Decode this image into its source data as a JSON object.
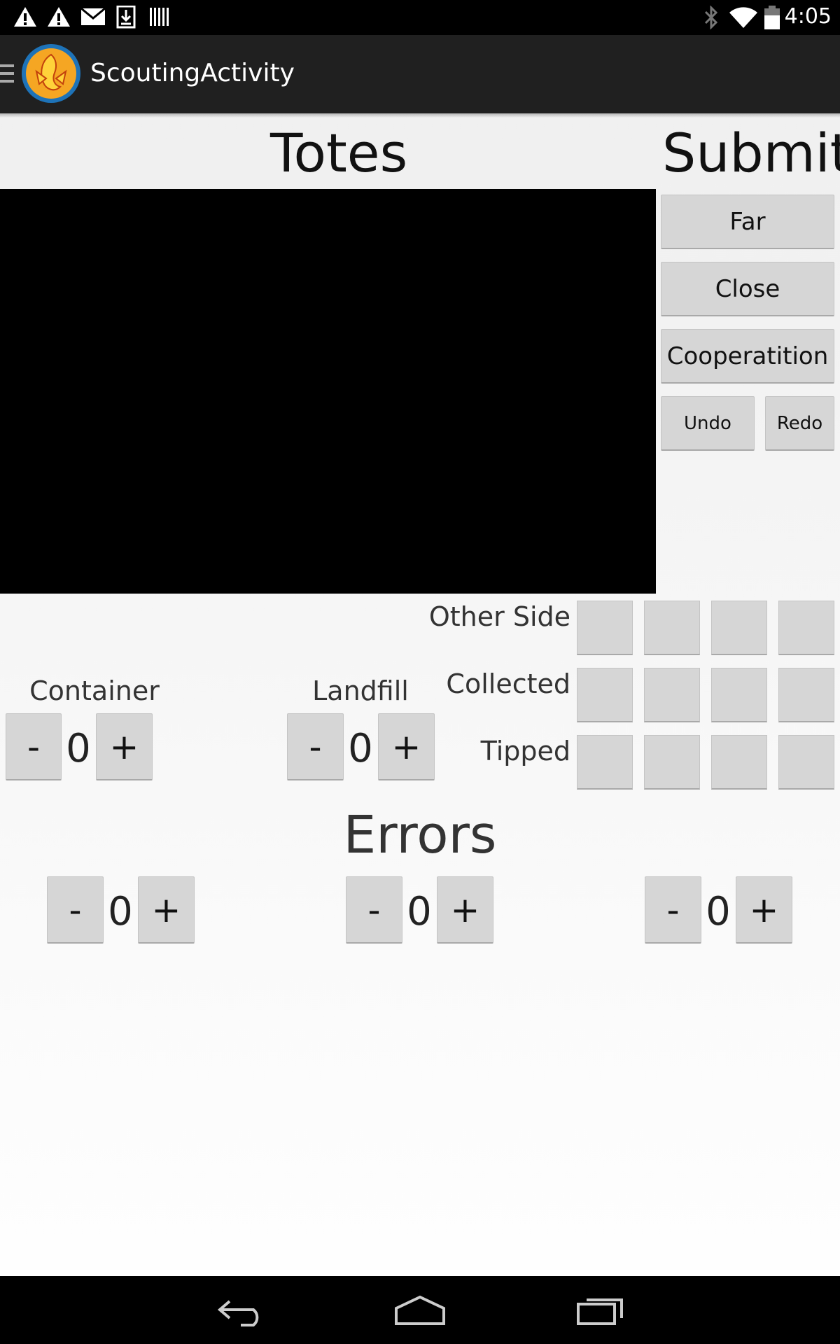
{
  "status_bar": {
    "time": "4:05",
    "left_icons": [
      "warning-icon",
      "warning-icon",
      "gmail-icon",
      "download-icon",
      "barcode-icon"
    ],
    "right_icons": [
      "bluetooth-icon",
      "wifi-icon",
      "battery-icon"
    ]
  },
  "action_bar": {
    "title": "ScoutingActivity",
    "logo_icon": "phoenix-logo-icon",
    "menu_icon": "hamburger-menu-icon"
  },
  "header": {
    "title": "Totes",
    "submit_label": "Submit"
  },
  "side_buttons": {
    "far": "Far",
    "close": "Close",
    "cooperatition": "Cooperatition",
    "undo": "Undo",
    "redo": "Redo"
  },
  "tote_grid": {
    "rows": [
      "Other Side",
      "Collected",
      "Tipped"
    ]
  },
  "counters": {
    "container": {
      "label": "Container",
      "value": "0",
      "minus": "-",
      "plus": "+"
    },
    "landfill": {
      "label": "Landfill",
      "value": "0",
      "minus": "-",
      "plus": "+"
    }
  },
  "errors": {
    "title": "Errors",
    "counters": [
      {
        "value": "0",
        "minus": "-",
        "plus": "+"
      },
      {
        "value": "0",
        "minus": "-",
        "plus": "+"
      },
      {
        "value": "0",
        "minus": "-",
        "plus": "+"
      }
    ]
  },
  "nav_bar": {
    "icons": [
      "back-icon",
      "home-icon",
      "recents-icon"
    ]
  }
}
